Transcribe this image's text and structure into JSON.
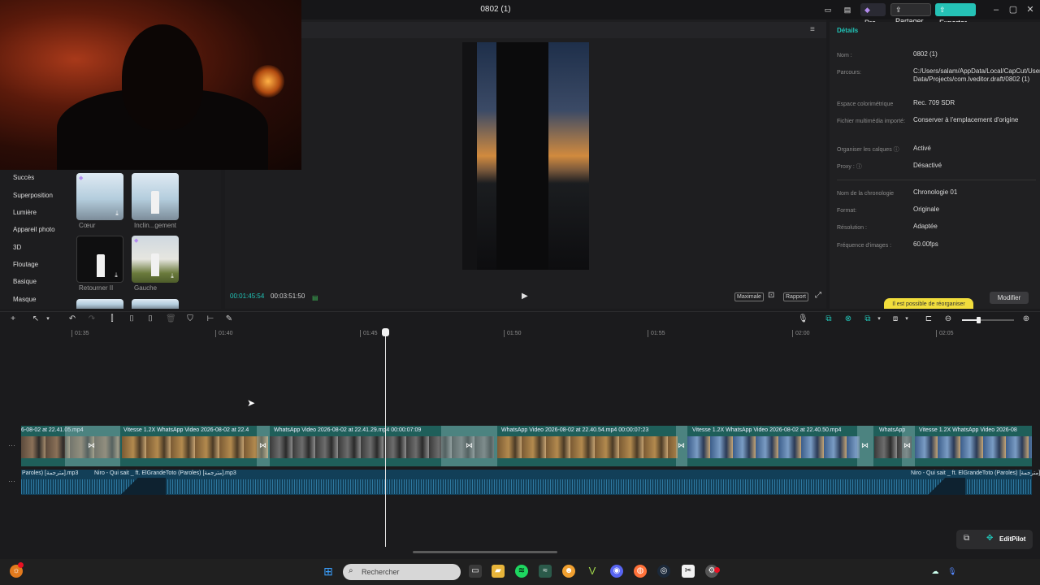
{
  "window": {
    "title": "0802 (1)",
    "pro_label": "Pro",
    "share_label": "Partager",
    "export_label": "Exporter"
  },
  "left_panel": {
    "categories": [
      "Succès",
      "Superposition",
      "Lumière",
      "Appareil photo",
      "3D",
      "Floutage",
      "Basique",
      "Masque"
    ],
    "thumbs": [
      {
        "caption": "Cœur"
      },
      {
        "caption": "Inclin...gement"
      },
      {
        "caption": "Retourner II"
      },
      {
        "caption": "Gauche"
      }
    ]
  },
  "preview": {
    "current_time": "00:01:45:54",
    "total_time": "00:03:51:50",
    "maximize_label": "Maximale",
    "ratio_label": "Rapport"
  },
  "details": {
    "title": "Détails",
    "rows": [
      {
        "label": "Nom :",
        "value": "0802 (1)"
      },
      {
        "label": "Parcours:",
        "value": "C:/Users/salam/AppData/Local/CapCut/User Data/Projects/com.lveditor.draft/0802 (1)"
      },
      {
        "label": "Espace colorimétrique",
        "value": "Rec. 709 SDR"
      },
      {
        "label": "Fichier multimédia importé:",
        "value": "Conserver à l'emplacement d'origine"
      },
      {
        "label": "Organiser les calques",
        "value": "Activé"
      },
      {
        "label": "Proxy :",
        "value": "Désactivé"
      },
      {
        "label": "Nom de la chronologie",
        "value": "Chronologie 01"
      },
      {
        "label": "Format:",
        "value": "Originale"
      },
      {
        "label": "Résolution :",
        "value": "Adaptée"
      },
      {
        "label": "Fréquence d'images :",
        "value": "60.00fps"
      }
    ],
    "reorg_label": "Il est possible de réorganiser",
    "modify_label": "Modifier"
  },
  "timeline": {
    "ticks": [
      "01:35",
      "01:40",
      "01:45",
      "01:50",
      "01:55",
      "02:00",
      "02:05"
    ],
    "clips": [
      {
        "label": "6-08-02 at 22.41.05.mp4"
      },
      {
        "label": "Vitesse 1.2X   WhatsApp Video 2026-08-02 at 22.4"
      },
      {
        "label": "WhatsApp Video 2026-08-02 at 22.41.29.mp4   00:00:07:09"
      },
      {
        "label": "WhatsApp Video 2026-08-02 at 22.40.54.mp4   00:00:07:23"
      },
      {
        "label": "Vitesse 1.2X   WhatsApp Video 2026-08-02 at 22.40.50.mp4"
      },
      {
        "label": "WhatsApp"
      },
      {
        "label": "Vitesse 1.2X   WhatsApp Video 2026-08"
      }
    ],
    "audio": [
      {
        "label": "Paroles) [مترجمة].mp3"
      },
      {
        "label": "Niro - Qui sait _ ft. ElGrandeToto (Paroles) [مترجمة].mp3"
      },
      {
        "label": "Niro - Qui sait _ ft. ElGrandeToto (Paroles) [مترجمة]"
      }
    ]
  },
  "editpilot": {
    "label": "EditPilot"
  },
  "taskbar": {
    "search_placeholder": "Rechercher"
  }
}
